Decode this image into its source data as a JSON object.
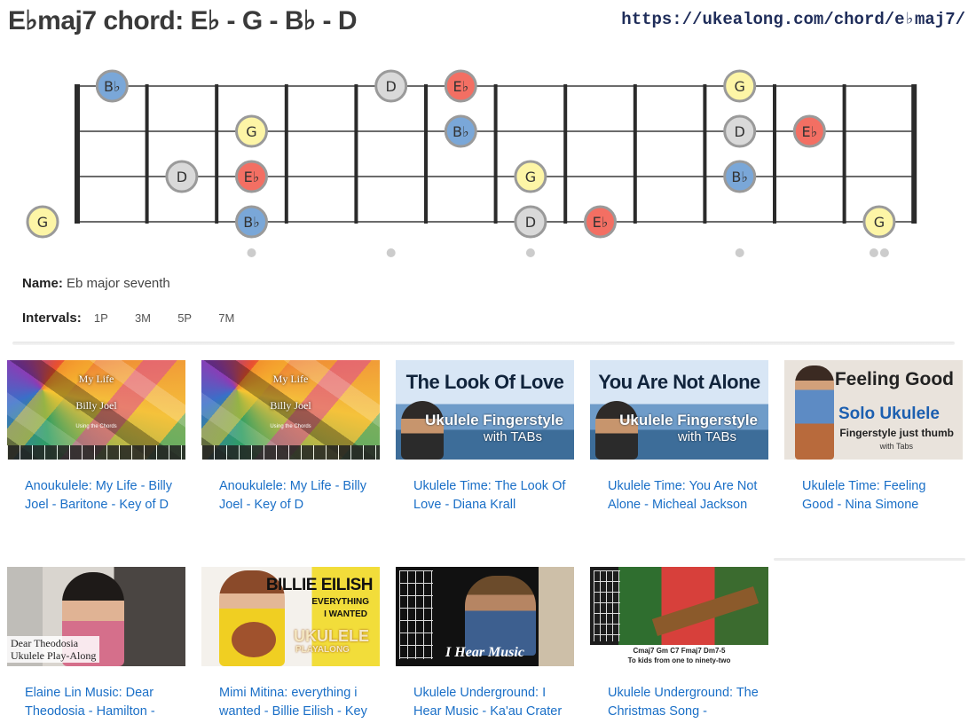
{
  "header": {
    "title": "E♭maj7 chord: E♭ - G - B♭ - D",
    "url": "https://ukealong.com/chord/e♭maj7/"
  },
  "fretboard": {
    "strings": 4,
    "frets": 12,
    "open_notes": [
      {
        "string": 4,
        "note": "G",
        "role": "third"
      }
    ],
    "notes": [
      {
        "string": 1,
        "fret": 1,
        "note": "B♭",
        "role": "fifth"
      },
      {
        "string": 1,
        "fret": 5,
        "note": "D",
        "role": "seventh"
      },
      {
        "string": 1,
        "fret": 6,
        "note": "E♭",
        "role": "root"
      },
      {
        "string": 1,
        "fret": 10,
        "note": "G",
        "role": "third"
      },
      {
        "string": 2,
        "fret": 3,
        "note": "G",
        "role": "third"
      },
      {
        "string": 2,
        "fret": 6,
        "note": "B♭",
        "role": "fifth"
      },
      {
        "string": 2,
        "fret": 10,
        "note": "D",
        "role": "seventh"
      },
      {
        "string": 2,
        "fret": 11,
        "note": "E♭",
        "role": "root"
      },
      {
        "string": 3,
        "fret": 2,
        "note": "D",
        "role": "seventh"
      },
      {
        "string": 3,
        "fret": 3,
        "note": "E♭",
        "role": "root"
      },
      {
        "string": 3,
        "fret": 7,
        "note": "G",
        "role": "third"
      },
      {
        "string": 3,
        "fret": 10,
        "note": "B♭",
        "role": "fifth"
      },
      {
        "string": 4,
        "fret": 3,
        "note": "B♭",
        "role": "fifth"
      },
      {
        "string": 4,
        "fret": 7,
        "note": "D",
        "role": "seventh"
      },
      {
        "string": 4,
        "fret": 8,
        "note": "E♭",
        "role": "root"
      },
      {
        "string": 4,
        "fret": 12,
        "note": "G",
        "role": "third"
      }
    ],
    "inlay_frets": [
      3,
      5,
      7,
      10
    ],
    "double_inlay_fret": 12,
    "colors": {
      "root": "#f36f63",
      "third": "#fdf5a6",
      "fifth": "#7aa7d8",
      "seventh": "#d9d9d9",
      "border": "#9a9a9a",
      "fret": "#2b2b2b",
      "string": "#6b6b6b",
      "inlay": "#cccccc"
    }
  },
  "info": {
    "name_label": "Name:",
    "name_value": "Eb major seventh",
    "intervals_label": "Intervals:",
    "intervals": [
      "1P",
      "3M",
      "5P",
      "7M"
    ]
  },
  "videos": [
    {
      "title": "Anoukulele: My Life - Billy Joel - Baritone - Key of D",
      "thumb": {
        "style": "mosaic",
        "line1": "My Life",
        "line2": "Billy Joel",
        "line3": "Using the Chords"
      }
    },
    {
      "title": "Anoukulele: My Life - Billy Joel - Key of D",
      "thumb": {
        "style": "mosaic",
        "line1": "My Life",
        "line2": "Billy Joel",
        "line3": "Using the Chords"
      }
    },
    {
      "title": "Ukulele Time: The Look Of Love - Diana Krall",
      "thumb": {
        "style": "sea",
        "big": "The Look Of Love",
        "sub1": "Ukulele Fingerstyle",
        "sub2": "with TABs"
      }
    },
    {
      "title": "Ukulele Time: You Are Not Alone - Micheal Jackson",
      "thumb": {
        "style": "sea",
        "big": "You Are Not Alone",
        "sub1": "Ukulele Fingerstyle",
        "sub2": "with TABs"
      }
    },
    {
      "title": "Ukulele Time: Feeling Good - Nina Simone",
      "thumb": {
        "style": "feel",
        "big": "Feeling Good",
        "solo": "Solo Ukulele",
        "finger": "Fingerstyle just thumb",
        "tabs": "with Tabs"
      }
    },
    {
      "title": "Elaine Lin Music: Dear Theodosia - Hamilton -",
      "thumb": {
        "style": "elaine",
        "cap1": "Dear Theodosia",
        "cap2": "Ukulele Play-Along"
      }
    },
    {
      "title": "Mimi Mitina: everything i wanted - Billie Eilish - Key",
      "thumb": {
        "style": "billie",
        "b1": "BILLIE EILISH",
        "b2": "EVERYTHING",
        "b3": "I WANTED",
        "b4": "UKULELE",
        "b5": "PLAYALONG"
      }
    },
    {
      "title": "Ukulele Underground: I Hear Music - Ka'au Crater",
      "thumb": {
        "style": "hear",
        "cap": "I Hear Music"
      }
    },
    {
      "title": "Ukulele Underground: The Christmas Song -",
      "thumb": {
        "style": "xmas",
        "bar1": "Cmaj7   Gm   C7   Fmaj7   Dm7-5",
        "bar2": "To kids from one to ninety-two"
      }
    }
  ]
}
